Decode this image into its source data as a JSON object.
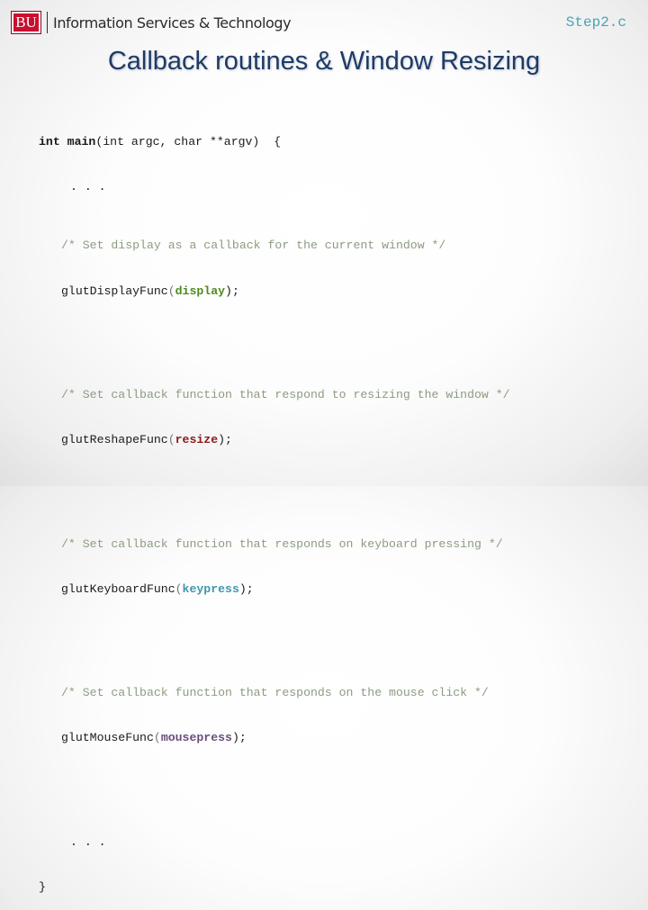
{
  "header": {
    "logo_text": "BU",
    "org_name": "Information Services & Technology",
    "file_label": "Step2.c"
  },
  "slide": {
    "title": "Callback routines & Window Resizing"
  },
  "code": {
    "signature": {
      "type1": "int",
      "name": "main",
      "params": "(int argc, char **argv)",
      "brace": "{"
    },
    "ellipsis_top": ". . .",
    "blocks": [
      {
        "comment": "/* Set display as a callback for the current window */",
        "func": "glutDisplayFunc",
        "arg": "display",
        "color": "#4f8a1e"
      },
      {
        "comment": "/* Set callback function that respond to resizing the window */",
        "func": "glutReshapeFunc",
        "arg": "resize",
        "color": "#8b1a1a"
      },
      {
        "comment": "/* Set callback function that responds on keyboard pressing */",
        "func": "glutKeyboardFunc",
        "arg": "keypress",
        "color": "#3f97b0"
      },
      {
        "comment": "/* Set callback function that responds on the mouse click */",
        "func": "glutMouseFunc",
        "arg": "mousepress",
        "color": "#6a4c7c"
      }
    ],
    "open_paren": "(",
    "close_paren": ");",
    "ellipsis_bottom": ". . .",
    "closing_brace": "}"
  },
  "colors": {
    "brand_red": "#c8102e",
    "title": "#1f3b64",
    "file_label": "#4aa3b8",
    "comment": "#8c9c80"
  }
}
